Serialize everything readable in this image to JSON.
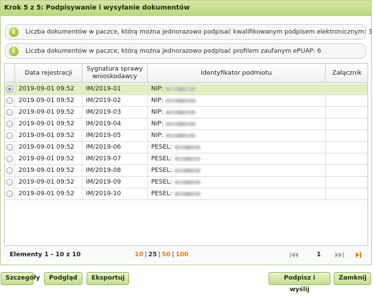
{
  "panel": {
    "title": "Krok 5 z 5: Podpisywanie i wysyłanie dokumentów"
  },
  "info": [
    {
      "icon": "info-icon",
      "text": "Liczba dokumentów w paczce, którą można jednorazowo podpisać kwalifikowanym podpisem elektronicznym: 3"
    },
    {
      "icon": "info-icon",
      "text": "Liczba dokumentów w paczce, którą można jednorazowo podpisać profilem zaufanym ePUAP: 6"
    }
  ],
  "grid": {
    "columns": [
      "Data rejestracji",
      "Sygnatura sprawy wnioskodawcy",
      "Identyfikator podmiotu",
      "Załącznik"
    ],
    "rows": [
      {
        "date": "2019-09-01 09:52",
        "signature": "IM/2019-01",
        "id_type": "NIP:",
        "attachment": "",
        "selected": true
      },
      {
        "date": "2019-09-01 09:52",
        "signature": "IM/2019-02",
        "id_type": "NIP:",
        "attachment": "",
        "selected": false
      },
      {
        "date": "2019-09-01 09:52",
        "signature": "IM/2019-03",
        "id_type": "NIP:",
        "attachment": "",
        "selected": false
      },
      {
        "date": "2019-09-01 09:52",
        "signature": "IM/2019-04",
        "id_type": "NIP:",
        "attachment": "",
        "selected": false
      },
      {
        "date": "2019-09-01 09:52",
        "signature": "IM/2019-05",
        "id_type": "NIP:",
        "attachment": "",
        "selected": false
      },
      {
        "date": "2019-09-01 09:52",
        "signature": "IM/2019-06",
        "id_type": "PESEL:",
        "attachment": "",
        "selected": false
      },
      {
        "date": "2019-09-01 09:52",
        "signature": "IM/2019-07",
        "id_type": "PESEL:",
        "attachment": "",
        "selected": false
      },
      {
        "date": "2019-09-01 09:52",
        "signature": "IM/2019-08",
        "id_type": "PESEL:",
        "attachment": "",
        "selected": false
      },
      {
        "date": "2019-09-01 09:52",
        "signature": "IM/2019-09",
        "id_type": "PESEL:",
        "attachment": "",
        "selected": false
      },
      {
        "date": "2019-09-01 09:52",
        "signature": "IM/2019-10",
        "id_type": "PESEL:",
        "attachment": "",
        "selected": false
      }
    ]
  },
  "pager": {
    "summary": "Elementy 1 - 10 z 10",
    "page_sizes": [
      "10",
      "25",
      "50",
      "100"
    ],
    "current_size": "10",
    "page": "1",
    "nav_icons": [
      "first-page-icon",
      "prev-page-icon",
      "next-page-icon",
      "last-page-icon"
    ]
  },
  "buttons": {
    "details": "Szczegóły",
    "preview": "Podgląd",
    "export": "Eksportuj",
    "sign_send": "Podpisz i wyślij",
    "close": "Zamknij"
  },
  "colors": {
    "accent": "#c4de8e",
    "selected_row": "#e2f0c1",
    "page_size_link": "#e07a10"
  }
}
